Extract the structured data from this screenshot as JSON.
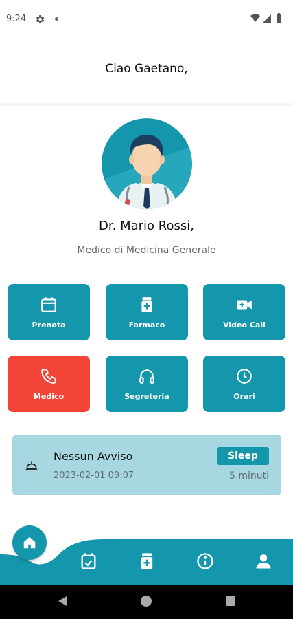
{
  "status_bar": {
    "time": "9:24"
  },
  "greeting": "Ciao Gaetano,",
  "doctor": {
    "name": "Dr. Mario Rossi,",
    "role": "Medico di Medicina Generale"
  },
  "tiles": [
    {
      "label": "Prenota",
      "icon": "calendar-icon"
    },
    {
      "label": "Farmaco",
      "icon": "medicine-icon"
    },
    {
      "label": "Video Call",
      "icon": "video-camera-icon"
    },
    {
      "label": "Medico",
      "icon": "phone-icon"
    },
    {
      "label": "Segreteria",
      "icon": "headset-icon"
    },
    {
      "label": "Orari",
      "icon": "clock-icon"
    }
  ],
  "notice": {
    "title": "Nessun Avviso",
    "date": "2023-02-01 09:07",
    "sleep_label": "Sleep",
    "minutes": "5 minuti"
  },
  "bottom_nav": [
    "home-icon",
    "calendar-check-icon",
    "medicine-icon",
    "info-icon",
    "person-icon"
  ],
  "colors": {
    "accent": "#1497ad",
    "alert": "#f24437",
    "notice_bg": "#a7d7e0"
  }
}
